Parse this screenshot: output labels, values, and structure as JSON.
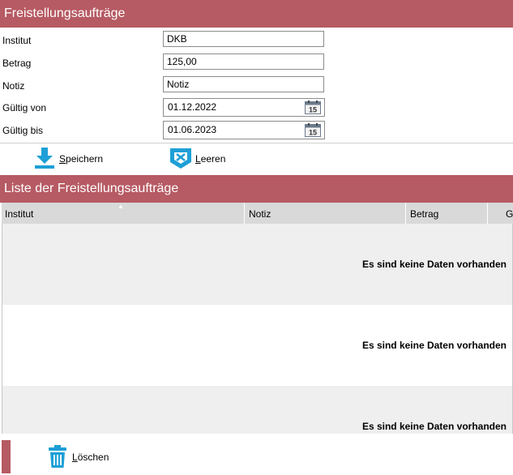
{
  "form_header": {
    "title": "Freistellungsaufträge"
  },
  "form": {
    "institut": {
      "label": "Institut",
      "value": "DKB"
    },
    "betrag": {
      "label": "Betrag",
      "value": "125,00"
    },
    "notiz": {
      "label": "Notiz",
      "value": "Notiz"
    },
    "gueltig_von": {
      "label": "Gültig von",
      "value": "01.12.2022",
      "calendar_day": "15"
    },
    "gueltig_bis": {
      "label": "Gültig bis",
      "value": "01.06.2023",
      "calendar_day": "15"
    }
  },
  "toolbar": {
    "save": {
      "accesskey": "S",
      "rest": "peichern",
      "icon": "download-icon"
    },
    "clear": {
      "accesskey": "L",
      "rest": "eeren",
      "icon": "eraser-icon"
    }
  },
  "list_header": {
    "title": "Liste der Freistellungsaufträge"
  },
  "table": {
    "columns": [
      "Institut",
      "Notiz",
      "Betrag",
      "G"
    ],
    "sort_indicator": "▲",
    "empty_message": "Es sind keine Daten vorhanden"
  },
  "footer": {
    "delete": {
      "accesskey": "L",
      "rest": "öschen",
      "icon": "trash-icon"
    }
  },
  "colors": {
    "accent": "#b65a63",
    "icon_blue": "#1e9fd6",
    "grid_header": "#d9d9d9",
    "row_alt": "#efefef"
  }
}
